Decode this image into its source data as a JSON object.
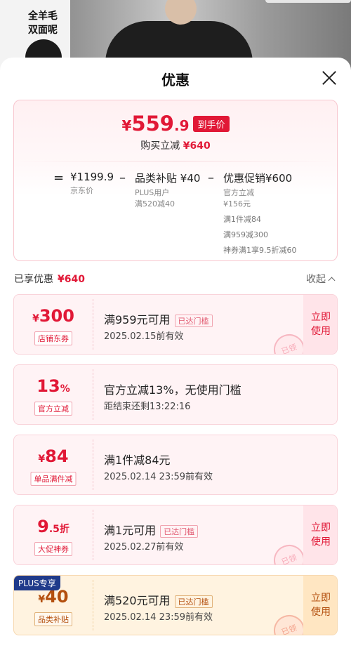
{
  "hero": {
    "label_line1": "全羊毛",
    "label_line2": "双面呢"
  },
  "sheet": {
    "title": "优惠"
  },
  "summary": {
    "currency": "¥",
    "price_int": "559",
    "price_dec": ".9",
    "price_tag": "到手价",
    "bought_label": "购买立减",
    "bought_amount": "¥640",
    "calc": {
      "equals": "=",
      "minus": "–",
      "base_price": "¥1199.9",
      "base_label": "京东价",
      "subsidy_title": "品类补贴",
      "subsidy_amount": "¥40",
      "subsidy_note1": "PLUS用户",
      "subsidy_note2": "满520减40",
      "promo_title": "优惠促销",
      "promo_amount": "¥600",
      "promo_note1": "官方立减",
      "promo_note2": "¥156元",
      "promo_note3": "满1件减84",
      "promo_note4": "满959减300",
      "promo_note5": "神券满1享9.5折减60"
    }
  },
  "enjoyed": {
    "label": "已享优惠",
    "amount": "¥640",
    "collapse_label": "收起"
  },
  "coupons": [
    {
      "currency": "¥",
      "value": "300",
      "unit": "",
      "type": "店铺东券",
      "desc": "满959元可用",
      "reached": "已达门槛",
      "validity": "2025.02.15前有效",
      "use_label": "立即使用",
      "stamp": "已领"
    },
    {
      "currency": "",
      "value": "13",
      "unit": "%",
      "type": "官方立减",
      "desc": "官方立减13%，无使用门槛",
      "reached": "",
      "validity": "距结束还剩13:22:16",
      "use_label": "",
      "stamp": ""
    },
    {
      "currency": "¥",
      "value": "84",
      "unit": "",
      "type": "单品满件减",
      "desc": "满1件减84元",
      "reached": "",
      "validity": "2025.02.14  23:59前有效",
      "use_label": "",
      "stamp": ""
    },
    {
      "currency": "",
      "value": "9",
      "unit": ".5折",
      "type": "大促神券",
      "desc": "满1元可用",
      "reached": "已达门槛",
      "validity": "2025.02.27前有效",
      "use_label": "立即使用",
      "stamp": "已领"
    },
    {
      "currency": "¥",
      "value": "40",
      "unit": "",
      "type": "品类补贴",
      "desc": "满520元可用",
      "reached": "已达门槛",
      "validity": "2025.02.14  23:59前有效",
      "use_label": "立即使用",
      "stamp": "已领",
      "badge": "PLUS专享"
    }
  ],
  "colors": {
    "accent": "#e11836",
    "gold": "#b4500f",
    "plus": "#1f3a8a"
  }
}
